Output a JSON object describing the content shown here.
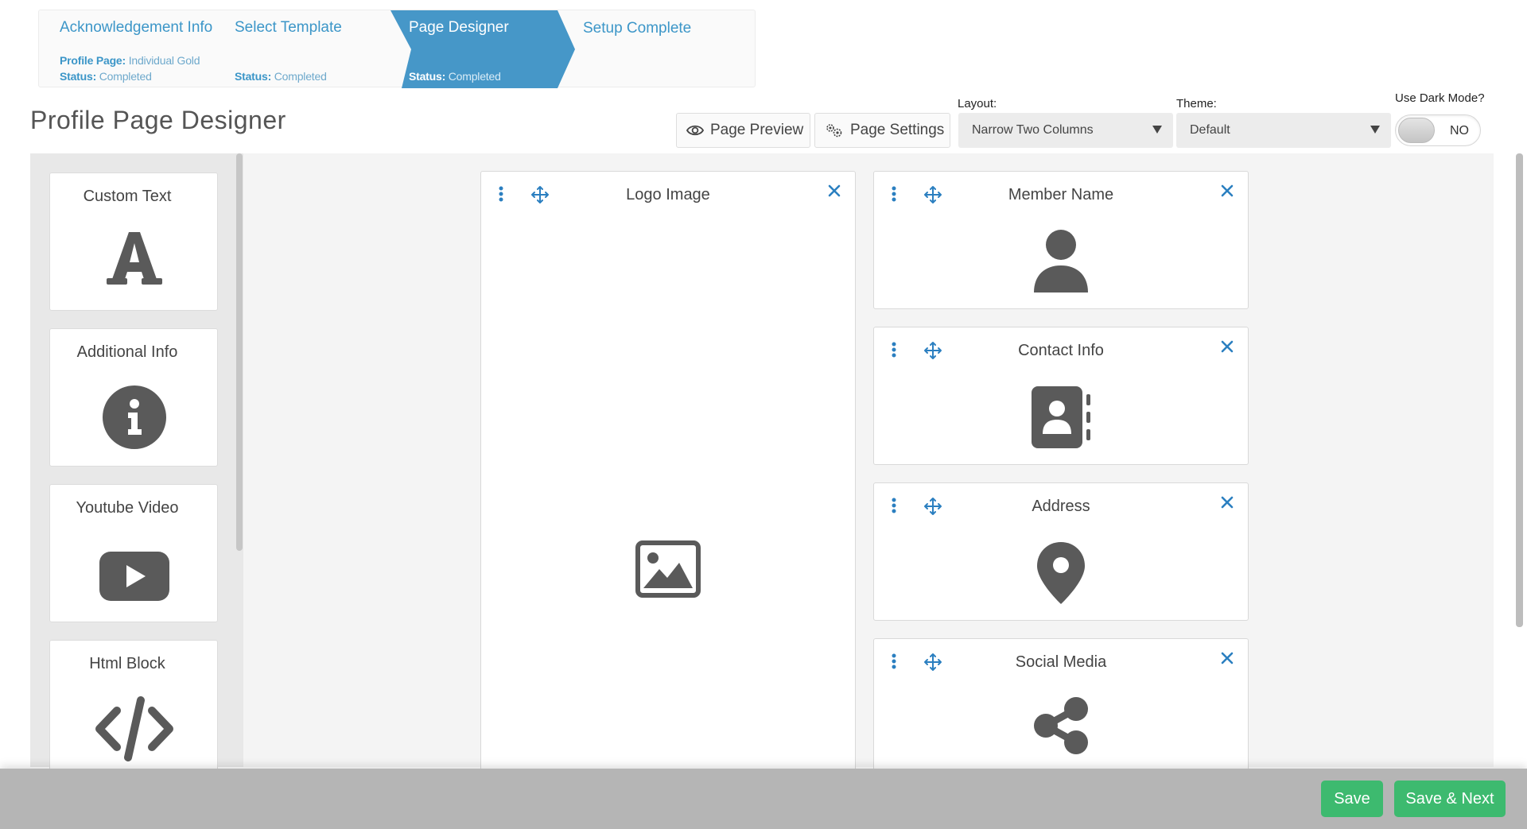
{
  "wizard": {
    "steps": [
      {
        "title": "Acknowledgement Info",
        "line1_label": "Profile Page:",
        "line1_value": "Individual Gold",
        "status_label": "Status:",
        "status_value": "Completed"
      },
      {
        "title": "Select Template",
        "status_label": "Status:",
        "status_value": "Completed"
      },
      {
        "title": "Page Designer",
        "status_label": "Status:",
        "status_value": "Completed"
      },
      {
        "title": "Setup Complete"
      }
    ],
    "active_color": "#4697c8"
  },
  "header": {
    "title": "Profile Page Designer",
    "page_preview_label": "Page Preview",
    "page_settings_label": "Page Settings",
    "layout_label": "Layout:",
    "layout_value": "Narrow Two Columns",
    "theme_label": "Theme:",
    "theme_value": "Default",
    "dark_mode_label": "Use Dark Mode?",
    "dark_mode_value": "NO"
  },
  "palette": {
    "items": [
      {
        "title": "Custom Text",
        "icon": "font-letter-a-icon"
      },
      {
        "title": "Additional Info",
        "icon": "info-circle-icon"
      },
      {
        "title": "Youtube Video",
        "icon": "youtube-icon"
      },
      {
        "title": "Html Block",
        "icon": "code-icon"
      }
    ]
  },
  "canvas": {
    "column1": [
      {
        "title": "Logo Image",
        "icon": "image-icon"
      }
    ],
    "column2": [
      {
        "title": "Member Name",
        "icon": "user-icon"
      },
      {
        "title": "Contact Info",
        "icon": "address-book-icon"
      },
      {
        "title": "Address",
        "icon": "map-marker-icon"
      },
      {
        "title": "Social Media",
        "icon": "share-icon"
      }
    ]
  },
  "footer": {
    "save_label": "Save",
    "save_next_label": "Save & Next"
  },
  "colors": {
    "accent_blue": "#3c96c8",
    "save_green": "#3dba6f",
    "icon_gray": "#5a5a5a"
  }
}
